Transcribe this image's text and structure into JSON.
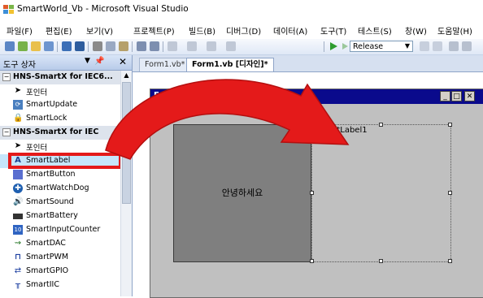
{
  "window": {
    "title": "SmartWorld_Vb - Microsoft Visual Studio"
  },
  "menu": [
    "파일(F)",
    "편집(E)",
    "보기(V)",
    "프로젝트(P)",
    "빌드(B)",
    "디버그(D)",
    "데이터(A)",
    "도구(T)",
    "테스트(S)",
    "창(W)",
    "도움말(H)"
  ],
  "toolbar": {
    "configuration": "Release"
  },
  "toolbox": {
    "title": "도구 상자",
    "items": [
      {
        "type": "group",
        "label": "HNS-SmartX for IEC6...",
        "icon": "minus-box-icon"
      },
      {
        "type": "item",
        "label": "포인터",
        "icon": "pointer-icon"
      },
      {
        "type": "item",
        "label": "SmartUpdate",
        "icon": "update-icon"
      },
      {
        "type": "item",
        "label": "SmartLock",
        "icon": "lock-icon"
      },
      {
        "type": "group",
        "label": "HNS-SmartX for IEC",
        "icon": "minus-box-icon"
      },
      {
        "type": "item",
        "label": "포인터",
        "icon": "pointer-icon"
      },
      {
        "type": "item",
        "label": "SmartLabel",
        "icon": "label-a-icon",
        "selected": true
      },
      {
        "type": "item",
        "label": "SmartButton",
        "icon": "button-icon"
      },
      {
        "type": "item",
        "label": "SmartWatchDog",
        "icon": "watchdog-icon"
      },
      {
        "type": "item",
        "label": "SmartSound",
        "icon": "speaker-icon"
      },
      {
        "type": "item",
        "label": "SmartBattery",
        "icon": "battery-icon"
      },
      {
        "type": "item",
        "label": "SmartInputCounter",
        "icon": "counter-icon"
      },
      {
        "type": "item",
        "label": "SmartDAC",
        "icon": "dac-icon"
      },
      {
        "type": "item",
        "label": "SmartPWM",
        "icon": "pwm-icon"
      },
      {
        "type": "item",
        "label": "SmartGPIO",
        "icon": "gpio-icon"
      },
      {
        "type": "item",
        "label": "SmartIIC",
        "icon": "iic-icon"
      }
    ]
  },
  "tabs": [
    {
      "label": "Form1.vb*",
      "active": false
    },
    {
      "label": "Form1.vb [디자인]*",
      "active": true
    }
  ],
  "designer": {
    "form_title": "Form1",
    "panel_text": "안녕하세요",
    "smartlabel_text": "SmartLabel1"
  },
  "colors": {
    "form_titlebar": "#0a0a8c",
    "form_bg": "#c0c0c0",
    "panel_bg": "#7f7f7f",
    "highlight_red": "#e41a1a",
    "selected_row": "#c6e6fb"
  }
}
